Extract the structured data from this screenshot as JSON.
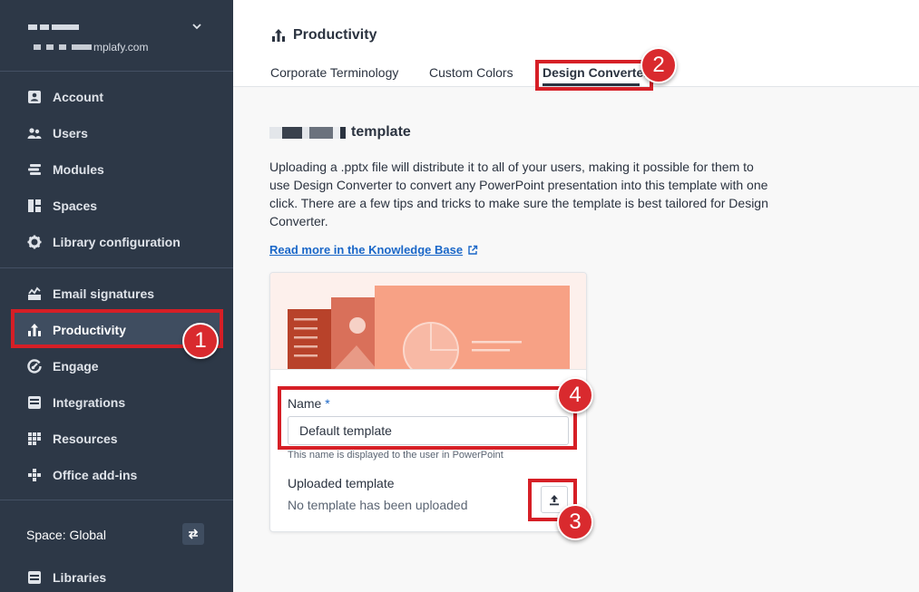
{
  "account": {
    "domain_suffix": "mplafy.com"
  },
  "sidebar": {
    "items": [
      {
        "label": "Account",
        "icon": "account-icon"
      },
      {
        "label": "Users",
        "icon": "users-icon"
      },
      {
        "label": "Modules",
        "icon": "modules-icon"
      },
      {
        "label": "Spaces",
        "icon": "spaces-icon"
      },
      {
        "label": "Library configuration",
        "icon": "gear-icon"
      },
      {
        "label": "Email signatures",
        "icon": "signature-icon"
      },
      {
        "label": "Productivity",
        "icon": "productivity-icon",
        "active": true
      },
      {
        "label": "Engage",
        "icon": "engage-icon"
      },
      {
        "label": "Integrations",
        "icon": "integrations-icon"
      },
      {
        "label": "Resources",
        "icon": "resources-icon"
      },
      {
        "label": "Office add-ins",
        "icon": "office-addins-icon"
      }
    ],
    "space_label": "Space: Global",
    "libraries_label": "Libraries"
  },
  "header": {
    "title": "Productivity",
    "tabs": [
      {
        "label": "Corporate Terminology"
      },
      {
        "label": "Custom Colors"
      },
      {
        "label": "Design Converter",
        "active": true
      }
    ]
  },
  "content": {
    "section_title_suffix": "template",
    "description": "Uploading a .pptx file will distribute it to all of your users, making it possible for them to use Design Converter to convert any PowerPoint presentation into this template with one click. There are a few tips and tricks to make sure the template is best tailored for Design Converter.",
    "kb_link": "Read more in the Knowledge Base",
    "name_label": "Name",
    "name_required": "*",
    "name_value": "Default template",
    "name_helper": "This name is displayed to the user in PowerPoint",
    "uploaded_label": "Uploaded template",
    "uploaded_status": "No template has been uploaded"
  },
  "annotations": [
    "1",
    "2",
    "3",
    "4"
  ],
  "colors": {
    "sidebar_bg": "#2d3847",
    "annotation_red": "#d61f26",
    "link_blue": "#1a67c8"
  }
}
